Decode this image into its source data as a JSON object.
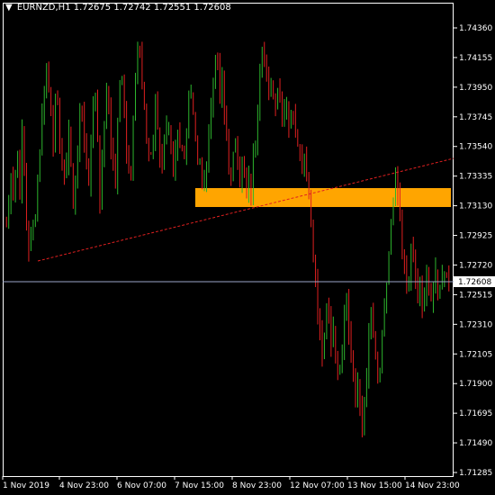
{
  "header": {
    "arrow_icon": "triangle-down-icon",
    "symbol": "EURNZD,H1",
    "open": "1.72675",
    "high": "1.72742",
    "low": "1.72551",
    "close": "1.72608"
  },
  "colors": {
    "background": "#000000",
    "bull": "#2db52d",
    "bear": "#e02020",
    "zone": "#ffa500",
    "trendline": "#e02020",
    "price_line": "#9aa4c8",
    "price_label_bg": "#ffffff",
    "grid_text": "#ffffff"
  },
  "chart_data": {
    "type": "candlestick",
    "title": "EURNZD,H1",
    "ylim": [
      1.7125,
      1.7448
    ],
    "y_ticks": [
      "1.74360",
      "1.74155",
      "1.73950",
      "1.73745",
      "1.73540",
      "1.73335",
      "1.73130",
      "1.72925",
      "1.72720",
      "1.72515",
      "1.72310",
      "1.72105",
      "1.71900",
      "1.71695",
      "1.71490",
      "1.71285"
    ],
    "x_ticks": [
      "1 Nov 2019",
      "4 Nov 23:00",
      "6 Nov 07:00",
      "7 Nov 15:00",
      "8 Nov 23:00",
      "12 Nov 07:00",
      "13 Nov 15:00",
      "14 Nov 23:00"
    ],
    "current_price": "1.72608",
    "support_zone": {
      "low": 1.7314,
      "high": 1.7327
    },
    "trendline": {
      "start_price": 1.7276,
      "end_price": 1.7345
    },
    "close_path": [
      1.73,
      1.7315,
      1.734,
      1.732,
      1.7335,
      1.7345,
      1.7325,
      1.736,
      1.734,
      1.73,
      1.7285,
      1.729,
      1.73,
      1.731,
      1.733,
      1.7355,
      1.7375,
      1.7395,
      1.741,
      1.7395,
      1.738,
      1.736,
      1.7385,
      1.738,
      1.736,
      1.734,
      1.733,
      1.7345,
      1.7365,
      1.734,
      1.731,
      1.733,
      1.735,
      1.7375,
      1.738,
      1.736,
      1.734,
      1.733,
      1.736,
      1.738,
      1.739,
      1.736,
      1.732,
      1.734,
      1.737,
      1.739,
      1.738,
      1.7355,
      1.734,
      1.733,
      1.737,
      1.7395,
      1.7405,
      1.738,
      1.735,
      1.7345,
      1.734,
      1.7375,
      1.74,
      1.742,
      1.7415,
      1.74,
      1.738,
      1.736,
      1.735,
      1.7345,
      1.736,
      1.7385,
      1.737,
      1.735,
      1.734,
      1.736,
      1.737,
      1.7365,
      1.735,
      1.733,
      1.7345,
      1.736,
      1.735,
      1.735,
      1.7345,
      1.737,
      1.739,
      1.739,
      1.738,
      1.736,
      1.734,
      1.734,
      1.733,
      1.7325,
      1.7345,
      1.7365,
      1.738,
      1.74,
      1.742,
      1.7405,
      1.7385,
      1.74,
      1.7375,
      1.736,
      1.734,
      1.733,
      1.7345,
      1.736,
      1.735,
      1.733,
      1.734,
      1.733,
      1.732,
      1.733,
      1.7325,
      1.7345,
      1.736,
      1.7385,
      1.741,
      1.7425,
      1.741,
      1.74,
      1.7385,
      1.74,
      1.739,
      1.7385,
      1.7395,
      1.739,
      1.7375,
      1.738,
      1.7385,
      1.737,
      1.7375,
      1.738,
      1.737,
      1.736,
      1.7345,
      1.734,
      1.735,
      1.734,
      1.732,
      1.73,
      1.728,
      1.726,
      1.724,
      1.7225,
      1.721,
      1.722,
      1.724,
      1.7235,
      1.722,
      1.723,
      1.7215,
      1.7195,
      1.7205,
      1.722,
      1.724,
      1.7255,
      1.723,
      1.721,
      1.7195,
      1.718,
      1.719,
      1.717,
      1.716,
      1.7175,
      1.72,
      1.722,
      1.724,
      1.7225,
      1.7205,
      1.719,
      1.72,
      1.722,
      1.724,
      1.726,
      1.728,
      1.73,
      1.731,
      1.733,
      1.732,
      1.73,
      1.728,
      1.727,
      1.7255,
      1.7265,
      1.728,
      1.7275,
      1.726,
      1.725,
      1.7255,
      1.724,
      1.725,
      1.7265,
      1.7255,
      1.7245,
      1.726,
      1.727,
      1.7255,
      1.725,
      1.7262,
      1.727,
      1.7262,
      1.7261
    ]
  }
}
